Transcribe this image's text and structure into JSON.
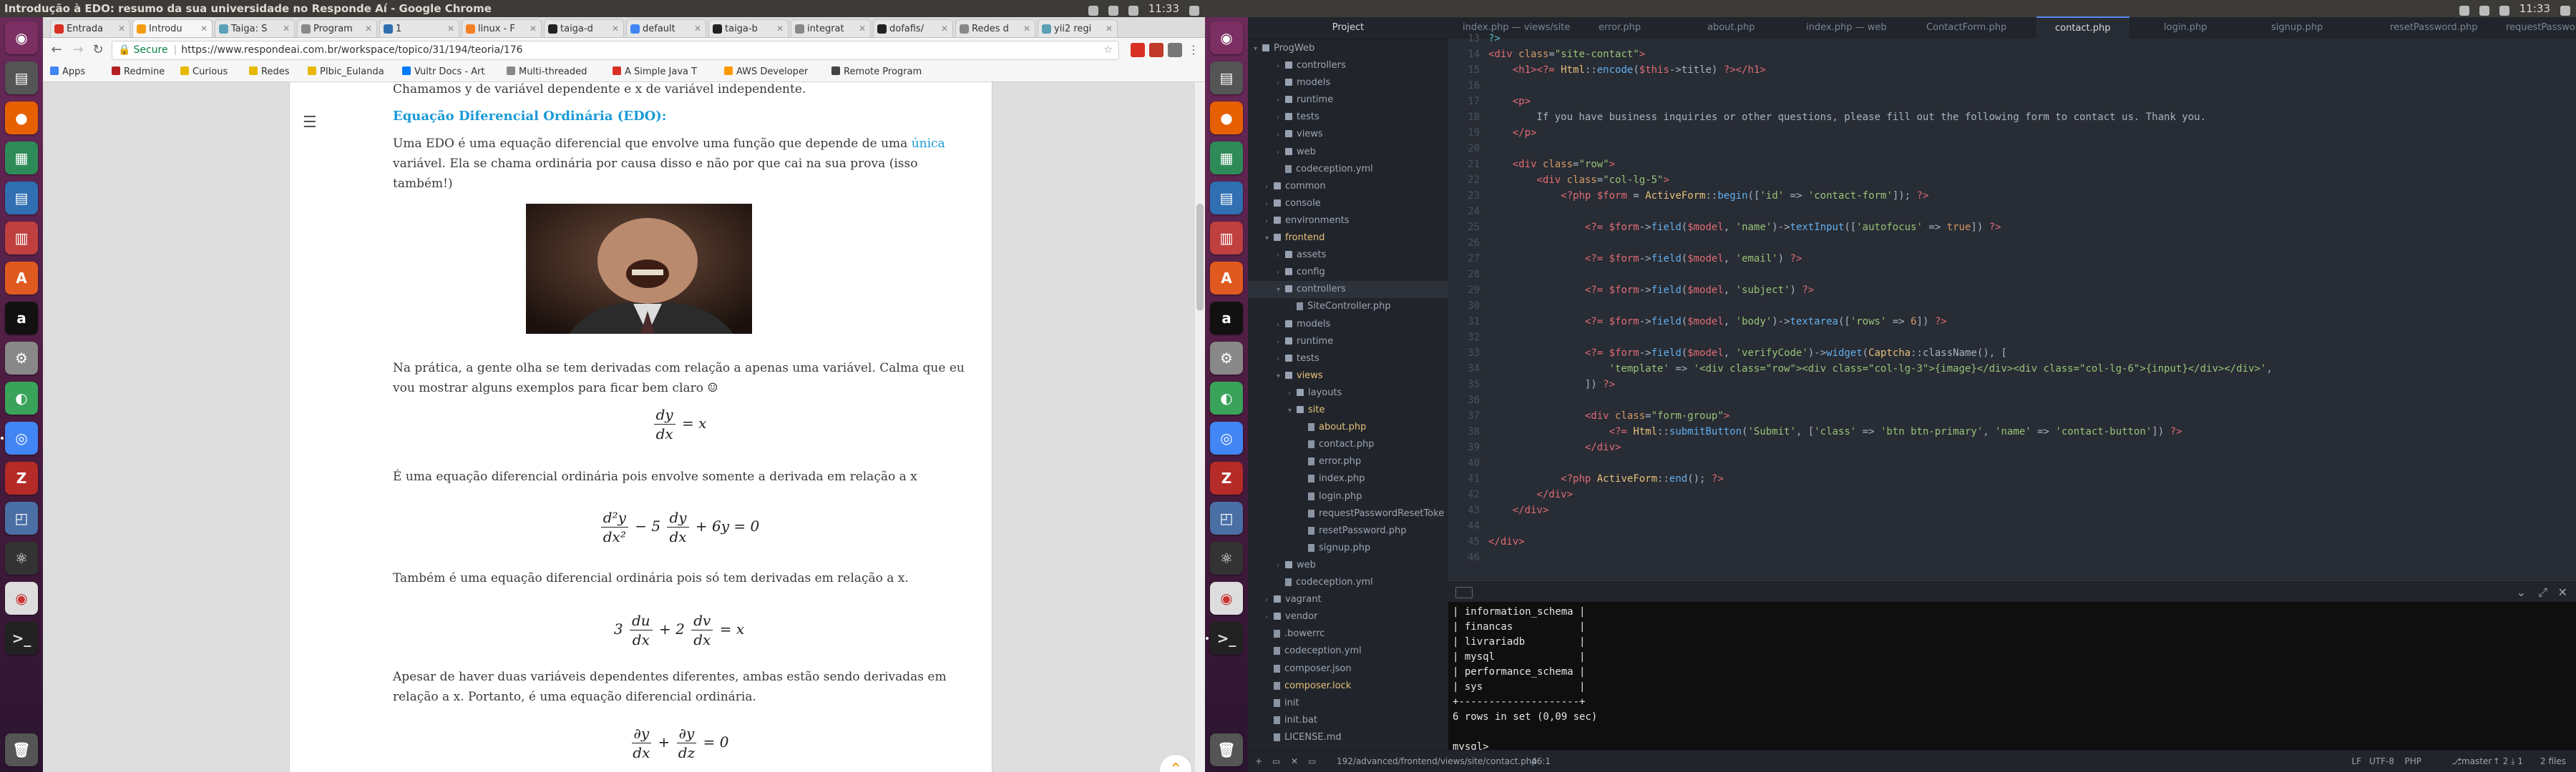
{
  "left": {
    "window_title": "Introdução à EDO: resumo da sua universidade no Responde Aí - Google Chrome",
    "clock": "11:33",
    "tabs": [
      "Entrada",
      "Introdu",
      "Taiga: S",
      "Program",
      "1",
      "linux - F",
      "taiga-d",
      "default",
      "taiga-b",
      "integrat",
      "dofafis/",
      "Redes d",
      "yii2 regi"
    ],
    "url": "https://www.respondeai.com.br/workspace/topico/31/194/teoria/176",
    "url_secure": "Secure",
    "bookmarks": [
      "Apps",
      "Redmine",
      "Curious",
      "Redes",
      "PIbic_Eulanda",
      "Vultr Docs - Art",
      "Multi-threaded",
      "A Simple Java T",
      "AWS Developer",
      "Remote Program"
    ],
    "page": {
      "intro_line": "Chamamos y de variável dependente e x de variável independente.",
      "edo_heading": "Equação Diferencial Ordinária (EDO):",
      "edo_para_1": "Uma EDO é uma equação diferencial que envolve uma função que depende de uma",
      "edo_para_highlight": "única",
      "edo_para_2": "variável. Ela se chama ordinária por causa disso e não por que cai na sua prova (isso também!)",
      "pratica": "Na prática, a gente olha se tem derivadas com relação a apenas uma variável. Calma que eu vou mostrar alguns exemplos para ficar bem claro ☺",
      "eq1_num": "dy",
      "eq1_den": "dx",
      "eq1_rhs": "= x",
      "p_ordinaria_1": "É uma equação diferencial ordinária pois envolve somente a derivada em relação a x",
      "eq2_t1_num": "d²y",
      "eq2_t1_den": "dx²",
      "eq2_mid": "− 5",
      "eq2_t2_num": "dy",
      "eq2_t2_den": "dx",
      "eq2_rhs": "+ 6y = 0",
      "p_ordinaria_2": "Também é uma equação diferencial ordinária pois só tem derivadas em relação a x.",
      "eq3_lead": "3",
      "eq3_t1_num": "du",
      "eq3_t1_den": "dx",
      "eq3_mid": "+ 2",
      "eq3_t2_num": "dv",
      "eq3_t2_den": "dx",
      "eq3_rhs": "= x",
      "p_ordinaria_3": "Apesar de haver duas variáveis dependentes diferentes, ambas estão sendo derivadas em relação a x. Portanto, é uma equação diferencial ordinária.",
      "eq4_t1_num": "∂y",
      "eq4_t1_den": "dx",
      "eq4_mid": "+",
      "eq4_t2_num": "∂y",
      "eq4_t2_den": "dz",
      "eq4_rhs": "= 0"
    }
  },
  "right": {
    "clock": "11:33",
    "tree_header": "Project",
    "tree": [
      {
        "label": "controllers",
        "depth": 2,
        "kind": "folder"
      },
      {
        "label": "models",
        "depth": 2,
        "kind": "folder"
      },
      {
        "label": "runtime",
        "depth": 2,
        "kind": "folder"
      },
      {
        "label": "tests",
        "depth": 2,
        "kind": "folder"
      },
      {
        "label": "views",
        "depth": 2,
        "kind": "folder"
      },
      {
        "label": "web",
        "depth": 2,
        "kind": "folder"
      },
      {
        "label": "codeception.yml",
        "depth": 2,
        "kind": "file"
      },
      {
        "label": "common",
        "depth": 1,
        "kind": "folder"
      },
      {
        "label": "console",
        "depth": 1,
        "kind": "folder"
      },
      {
        "label": "environments",
        "depth": 1,
        "kind": "folder"
      },
      {
        "label": "frontend",
        "depth": 1,
        "kind": "folder-open-mod"
      },
      {
        "label": "assets",
        "depth": 2,
        "kind": "folder"
      },
      {
        "label": "config",
        "depth": 2,
        "kind": "folder"
      },
      {
        "label": "controllers",
        "depth": 2,
        "kind": "folder-open-sel"
      },
      {
        "label": "SiteController.php",
        "depth": 3,
        "kind": "file"
      },
      {
        "label": "models",
        "depth": 2,
        "kind": "folder"
      },
      {
        "label": "runtime",
        "depth": 2,
        "kind": "folder"
      },
      {
        "label": "tests",
        "depth": 2,
        "kind": "folder"
      },
      {
        "label": "views",
        "depth": 2,
        "kind": "folder-open-mod"
      },
      {
        "label": "layouts",
        "depth": 3,
        "kind": "folder"
      },
      {
        "label": "site",
        "depth": 3,
        "kind": "folder-open-mod"
      },
      {
        "label": "about.php",
        "depth": 4,
        "kind": "file-mod"
      },
      {
        "label": "contact.php",
        "depth": 4,
        "kind": "file"
      },
      {
        "label": "error.php",
        "depth": 4,
        "kind": "file"
      },
      {
        "label": "index.php",
        "depth": 4,
        "kind": "file"
      },
      {
        "label": "login.php",
        "depth": 4,
        "kind": "file"
      },
      {
        "label": "requestPasswordResetToke",
        "depth": 4,
        "kind": "file"
      },
      {
        "label": "resetPassword.php",
        "depth": 4,
        "kind": "file"
      },
      {
        "label": "signup.php",
        "depth": 4,
        "kind": "file"
      },
      {
        "label": "web",
        "depth": 2,
        "kind": "folder"
      },
      {
        "label": "codeception.yml",
        "depth": 2,
        "kind": "file"
      },
      {
        "label": "vagrant",
        "depth": 1,
        "kind": "folder"
      },
      {
        "label": "vendor",
        "depth": 1,
        "kind": "folder"
      },
      {
        "label": ".bowerrc",
        "depth": 1,
        "kind": "file"
      },
      {
        "label": "codeception.yml",
        "depth": 1,
        "kind": "file"
      },
      {
        "label": "composer.json",
        "depth": 1,
        "kind": "file"
      },
      {
        "label": "composer.lock",
        "depth": 1,
        "kind": "file-mod"
      },
      {
        "label": "init",
        "depth": 1,
        "kind": "file"
      },
      {
        "label": "init.bat",
        "depth": 1,
        "kind": "file"
      },
      {
        "label": "LICENSE.md",
        "depth": 1,
        "kind": "file"
      }
    ],
    "tree_root": "ProgWeb",
    "editor_tabs": [
      "index.php — views/site",
      "error.php",
      "about.php",
      "index.php — web",
      "ContactForm.php",
      "contact.php",
      "login.php",
      "signup.php",
      "resetPassword.php",
      "requestPasswordReset"
    ],
    "active_tab": 5,
    "line_numbers": [
      "13",
      "14",
      "15",
      "16",
      "17",
      "18",
      "19",
      "20",
      "21",
      "22",
      "23",
      "24",
      "25",
      "26",
      "27",
      "28",
      "29",
      "30",
      "31",
      "32",
      "33",
      "34",
      "35",
      "36",
      "37",
      "38",
      "39",
      "40",
      "41",
      "42",
      "43",
      "44",
      "45",
      "46"
    ],
    "terminal_lines": [
      "| information_schema |",
      "| financas           |",
      "| livrariadb         |",
      "| mysql              |",
      "| performance_schema |",
      "| sys                |",
      "+--------------------+",
      "6 rows in set (0,09 sec)",
      "",
      "mysql>"
    ],
    "status": {
      "path": "192/advanced/frontend/views/site/contact.php",
      "cursor": "46:1",
      "line_ending": "LF",
      "encoding": "UTF-8",
      "grammar": "PHP",
      "branch": "master",
      "git": "↑ 2  ⤓ 1",
      "files": "2 files"
    }
  }
}
